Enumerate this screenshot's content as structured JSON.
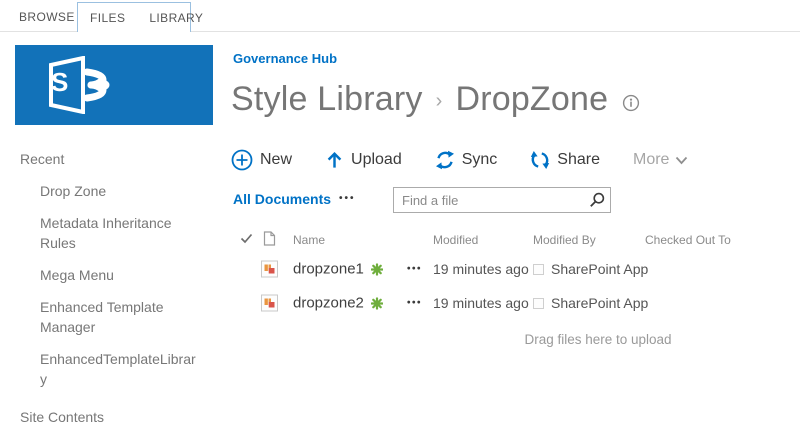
{
  "colors": {
    "accent_blue": "#0072c6",
    "logo_blue": "#1272b9",
    "tab_box_border": "#9bc0e0",
    "title_gray": "#767676",
    "muted_text": "#8a8a8a",
    "new_burst_green": "#6fae3d",
    "file_icon_orange": "#e9953f",
    "file_icon_red": "#d9544a"
  },
  "ribbon": {
    "tabs": [
      {
        "label": "BROWSE"
      },
      {
        "label": "FILES"
      },
      {
        "label": "LIBRARY"
      }
    ]
  },
  "branding": {
    "logo_letter": "S",
    "logo_icon": "sharepoint-logo"
  },
  "breadcrumb": {
    "site_link": "Governance Hub"
  },
  "title": {
    "library": "Style Library",
    "separator": "›",
    "current": "DropZone",
    "info_icon": "info-icon"
  },
  "toolbar": {
    "actions": [
      {
        "label": "New",
        "icon": "new-plus-circle-icon"
      },
      {
        "label": "Upload",
        "icon": "upload-arrow-icon"
      },
      {
        "label": "Sync",
        "icon": "sync-arrows-icon"
      },
      {
        "label": "Share",
        "icon": "share-arrows-icon"
      },
      {
        "label": "More",
        "icon": "chevron-down-icon"
      }
    ]
  },
  "view_bar": {
    "current_view": "All Documents",
    "more_views_ellipsis": "•••",
    "search_placeholder": "Find a file",
    "search_icon": "magnifier-icon"
  },
  "table": {
    "headers": {
      "select_all_icon": "checkmark-icon",
      "type_icon": "document-icon",
      "name": "Name",
      "modified": "Modified",
      "modified_by": "Modified By",
      "checked_out_to": "Checked Out To"
    },
    "rows": [
      {
        "name": "dropzone1",
        "is_new": true,
        "row_menu_ellipsis": "•••",
        "modified": "19 minutes ago",
        "modified_by": "SharePoint App",
        "checked_out_to": ""
      },
      {
        "name": "dropzone2",
        "is_new": true,
        "row_menu_ellipsis": "•••",
        "modified": "19 minutes ago",
        "modified_by": "SharePoint App",
        "checked_out_to": ""
      }
    ],
    "drop_hint": "Drag files here to upload"
  },
  "sidebar": {
    "items": [
      {
        "label": "Recent",
        "level": 0
      },
      {
        "label": "Drop Zone",
        "level": 1
      },
      {
        "label": "Metadata Inheritance Rules",
        "level": 1
      },
      {
        "label": "Mega Menu",
        "level": 1
      },
      {
        "label": "Enhanced Template Manager",
        "level": 1
      },
      {
        "label": "EnhancedTemplateLibrary",
        "level": 1
      },
      {
        "label": "Site Contents",
        "level": 0
      }
    ]
  }
}
